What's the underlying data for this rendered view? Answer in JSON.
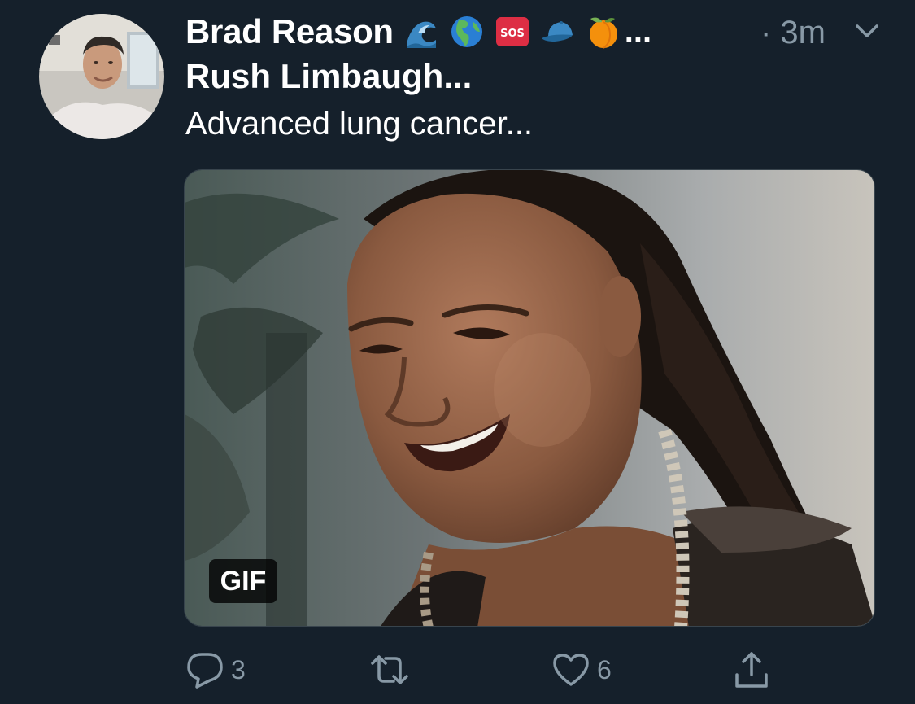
{
  "tweet": {
    "display_name": "Brad Reason",
    "name_emojis": [
      "water-wave-icon",
      "globe-americas-icon",
      "sos-button-icon",
      "blue-cap-icon",
      "peach-icon"
    ],
    "name_truncation": "...",
    "timestamp": "· 3m",
    "text_line_1": "Rush Limbaugh...",
    "text_line_2": "Advanced lung cancer...",
    "media": {
      "badge": "GIF"
    }
  },
  "actions": {
    "reply_count": "3",
    "retweet_count": "",
    "like_count": "6"
  },
  "colors": {
    "background": "#15202b",
    "secondary_text": "#8899a6",
    "primary_text": "#ffffff"
  }
}
